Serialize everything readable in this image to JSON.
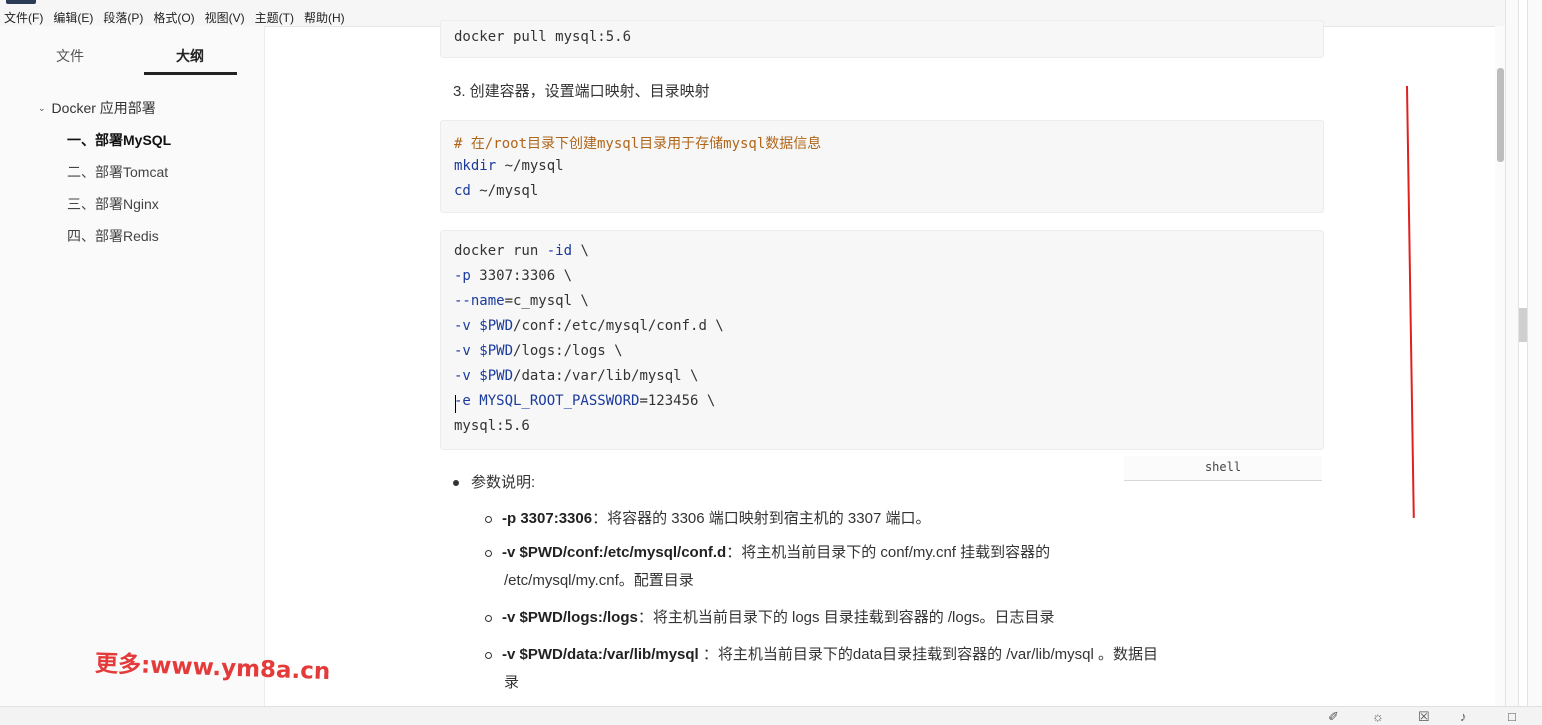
{
  "menu": [
    "文件(F)",
    "编辑(E)",
    "段落(P)",
    "格式(O)",
    "视图(V)",
    "主题(T)",
    "帮助(H)"
  ],
  "sidebar": {
    "tabs": {
      "files": "文件",
      "outline": "大纲"
    },
    "root": "Docker 应用部署",
    "items": [
      "一、部署MySQL",
      "二、部署Tomcat",
      "三、部署Nginx",
      "四、部署Redis"
    ]
  },
  "watermark": "更多:www.ym8a.cn",
  "doc": {
    "pull_line": "docker pull mysql:5.6",
    "step3": "3. 创建容器，设置端口映射、目录映射",
    "block2": {
      "comment": "# 在/root目录下创建mysql目录用于存储mysql数据信息",
      "l2_cmd": "mkdir",
      "l2_arg": " ~/mysql",
      "l3_cmd": "cd",
      "l3_arg": " ~/mysql"
    },
    "block3": {
      "l1a": "docker run ",
      "l1b": "-id",
      "l1c": " \\",
      "l2a": "-p",
      "l2b": " 3307:3306 \\",
      "l3a": "--name",
      "l3b": "=c_mysql \\",
      "l4a": "-v",
      "l4b": " $PWD",
      "l4c": "/conf:/etc/mysql/conf.d \\",
      "l5a": "-v",
      "l5b": " $PWD",
      "l5c": "/logs:/logs \\",
      "l6a": "-v",
      "l6b": " $PWD",
      "l6c": "/data:/var/lib/mysql \\",
      "l7a": "-e",
      "l7b": " MYSQL_ROOT_PASSWORD",
      "l7c": "=123456 \\",
      "l8": "mysql:5.6"
    },
    "lang": "shell",
    "bullet": "参数说明:",
    "params": [
      {
        "flag": "-p 3307:3306",
        "desc": "：将容器的 3306 端口映射到宿主机的 3307 端口。",
        "cont": ""
      },
      {
        "flag": "-v $PWD/conf:/etc/mysql/conf.d",
        "desc": "：将主机当前目录下的 conf/my.cnf 挂载到容器的",
        "cont": "/etc/mysql/my.cnf。配置目录"
      },
      {
        "flag": "-v $PWD/logs:/logs",
        "desc": "：将主机当前目录下的 logs 目录挂载到容器的 /logs。日志目录",
        "cont": ""
      },
      {
        "flag": "-v $PWD/data:/var/lib/mysql",
        "desc": " ：将主机当前目录下的data目录挂载到容器的 /var/lib/mysql 。数据目",
        "cont": "录"
      }
    ]
  },
  "colors": {
    "accent_red": "#e02020",
    "keyword_blue": "#1a3a9c",
    "comment_orange": "#b0661a"
  }
}
